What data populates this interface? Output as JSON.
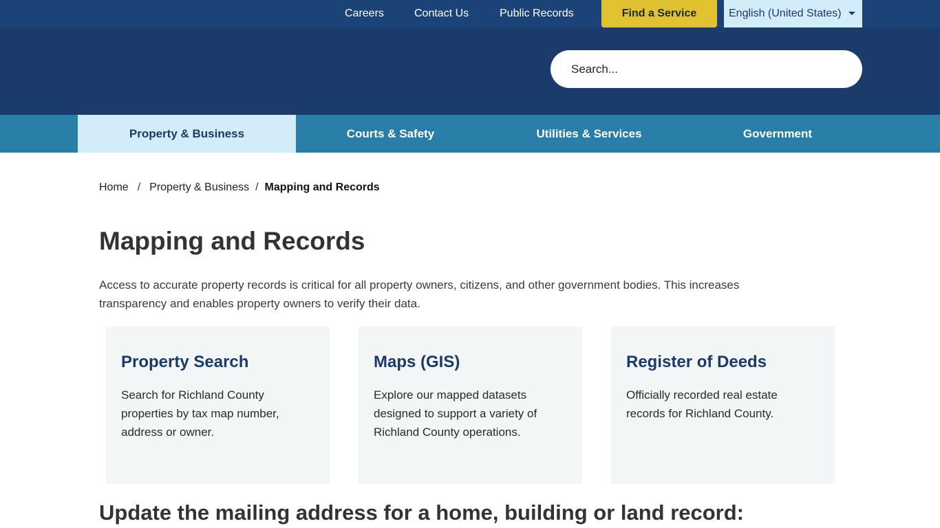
{
  "topbar": {
    "links": [
      "Careers",
      "Contact Us",
      "Public Records"
    ],
    "find_service": "Find a Service",
    "language": "English (United States)"
  },
  "header": {
    "search_placeholder": "Search..."
  },
  "nav": {
    "items": [
      "Property & Business",
      "Courts & Safety",
      "Utilities & Services",
      "Government"
    ],
    "active": "Property & Business"
  },
  "breadcrumb": {
    "items": [
      "Home",
      "Property & Business"
    ],
    "current": "Mapping and Records",
    "separator": "/"
  },
  "page": {
    "title": "Mapping and Records",
    "intro": "Access to accurate property records is critical for all property owners, citizens, and other government bodies. This increases transparency and enables property owners to verify their data.",
    "cards": [
      {
        "title": "Property Search",
        "text": "Search for Richland County properties by tax map number, address or owner."
      },
      {
        "title": "Maps (GIS)",
        "text": "Explore our mapped datasets designed to support a variety of Richland County operations."
      },
      {
        "title": "Register of Deeds",
        "text": "Officially recorded real estate records for Richland County."
      }
    ],
    "subheading": "Update the mailing address for a home, building or land record:"
  },
  "colors": {
    "topbar": "#1b4378",
    "header": "#1b3b6b",
    "nav": "#287ea6",
    "nav_active": "#d3ecfa",
    "find_button": "#e0c130",
    "card_bg": "#f2f6f7",
    "card_title": "#1b3a66"
  }
}
